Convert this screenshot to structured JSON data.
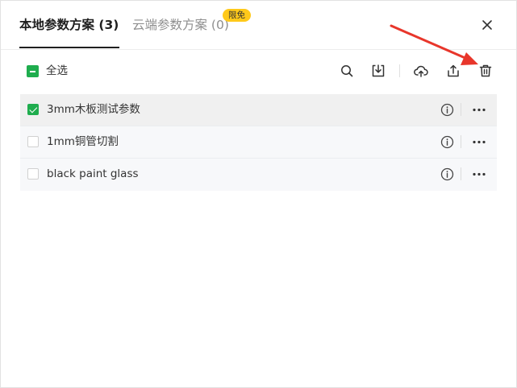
{
  "tabs": {
    "local_label": "本地参数方案 (3)",
    "cloud_label": "云端参数方案 (0)",
    "cloud_badge": "限免"
  },
  "toolbar": {
    "select_all_label": "全选",
    "icons": [
      "search-icon",
      "import-icon",
      "cloud-upload-icon",
      "export-icon",
      "delete-icon"
    ]
  },
  "plans": [
    {
      "name": "3mm木板测试参数",
      "checked": true
    },
    {
      "name": "1mm铜管切割",
      "checked": false
    },
    {
      "name": "black paint glass",
      "checked": false
    }
  ],
  "colors": {
    "accent_green": "#1fad4e",
    "badge_yellow": "#ffc91a",
    "annotation_red": "#e8362b"
  }
}
